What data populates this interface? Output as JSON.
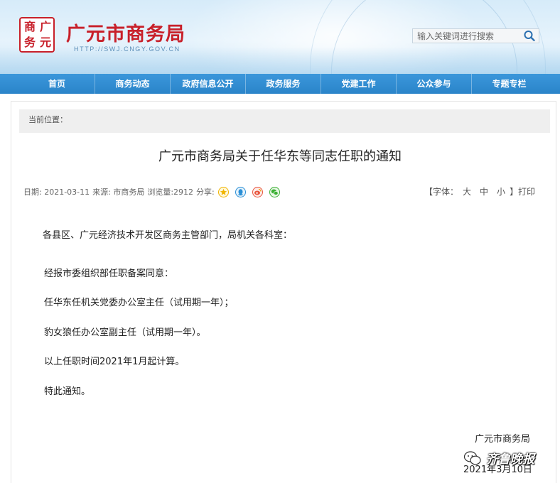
{
  "header": {
    "logo_chars": [
      "商",
      "广",
      "务",
      "元"
    ],
    "site_name": "广元市商务局",
    "site_url": "HTTP://SWJ.CNGY.GOV.CN",
    "search_placeholder": "输入关键词进行搜索"
  },
  "nav": {
    "items": [
      "首页",
      "商务动态",
      "政府信息公开",
      "政务服务",
      "党建工作",
      "公众参与",
      "专题专栏"
    ]
  },
  "breadcrumb": {
    "label": "当前位置："
  },
  "article": {
    "title": "广元市商务局关于任华东等同志任职的通知",
    "meta": {
      "date": "日期: 2021-03-11",
      "source": "来源: 市商务局",
      "views": "浏览量:2912",
      "share_label": "分享:"
    },
    "font_label": "【字体：",
    "font_large": "大",
    "font_medium": "中",
    "font_small": "小",
    "font_close": "】",
    "print_label": "打印",
    "paragraphs": [
      "各县区、广元经济技术开发区商务主管部门，局机关各科室：",
      "经报市委组织部任职备案同意：",
      "任华东任机关党委办公室主任（试用期一年）；",
      "豹女狼任办公室副主任（试用期一年）。",
      "以上任职时间2021年1月起计算。",
      "特此通知。"
    ],
    "signature": "广元市商务局",
    "sign_date": "2021年3月10日"
  },
  "watermark": {
    "text": "齐鲁晚报"
  },
  "colors": {
    "brand_red": "#c8202a",
    "nav_blue": "#2a84c9"
  }
}
